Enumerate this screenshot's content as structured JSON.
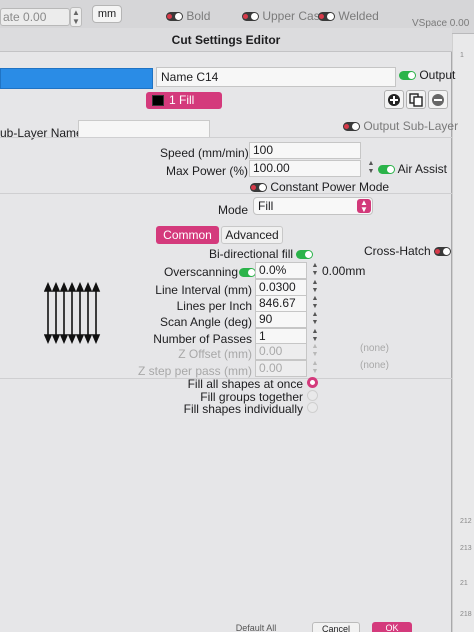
{
  "background_toolbar": {
    "field_value": "ate 0.00",
    "unit": "mm",
    "bold_label": "Bold",
    "upper_case_label": "Upper Case",
    "welded_label": "Welded",
    "vspace_label": "VSpace 0.00"
  },
  "ruler": {
    "marks": [
      "1",
      "212",
      "213",
      "21",
      "218"
    ]
  },
  "dialog": {
    "title": "Cut Settings Editor",
    "name_label": "Name C14",
    "output_label": "Output",
    "layer_button_label": "1 Fill",
    "sublayer_label": "ub-Layer Name",
    "sublayer_value": "",
    "output_sublayer_label": "Output Sub-Layer"
  },
  "settings": {
    "speed": {
      "label": "Speed (mm/min)",
      "value": "100"
    },
    "max_power": {
      "label": "Max Power (%)",
      "value": "100.00"
    },
    "air_assist_label": "Air Assist",
    "constant_power_label": "Constant Power Mode",
    "mode": {
      "label": "Mode",
      "value": "Fill"
    }
  },
  "tabs": {
    "common": "Common",
    "advanced": "Advanced"
  },
  "fill": {
    "bidirectional_label": "Bi-directional fill",
    "crosshatch_label": "Cross-Hatch",
    "overscanning": {
      "label": "Overscanning",
      "value": "0.0%",
      "mm_value": "0.00mm"
    },
    "line_interval": {
      "label": "Line Interval (mm)",
      "value": "0.0300"
    },
    "lines_per_inch": {
      "label": "Lines per Inch",
      "value": "846.67"
    },
    "scan_angle": {
      "label": "Scan Angle (deg)",
      "value": "90"
    },
    "number_of_passes": {
      "label": "Number of Passes",
      "value": "1"
    },
    "z_offset": {
      "label": "Z Offset (mm)",
      "value": "0.00",
      "none": "(none)"
    },
    "z_step": {
      "label": "Z step per pass (mm)",
      "value": "0.00",
      "none": "(none)"
    }
  },
  "fill_options": [
    {
      "label": "Fill all shapes at once",
      "checked": true
    },
    {
      "label": "Fill groups together",
      "checked": false
    },
    {
      "label": "Fill shapes individually",
      "checked": false
    }
  ],
  "bottom": {
    "left_label": "Default All",
    "cancel": "Cancel",
    "ok": "OK"
  },
  "colors": {
    "accent": "#d43a7c",
    "selection_blue": "#2a8ce6",
    "toggle_on": "#2bb34a"
  }
}
